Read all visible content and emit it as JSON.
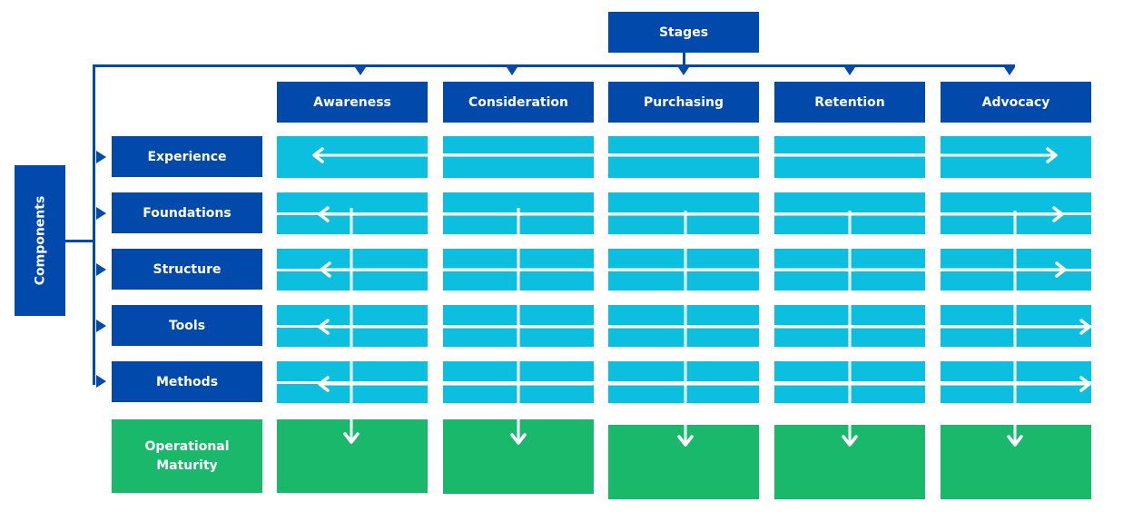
{
  "diagram": {
    "stages_header": "Stages",
    "components_header": "Components",
    "stages": [
      {
        "label": "Awareness"
      },
      {
        "label": "Consideration"
      },
      {
        "label": "Purchasing"
      },
      {
        "label": "Retention"
      },
      {
        "label": "Advocacy"
      }
    ],
    "components": [
      {
        "label": "Experience"
      },
      {
        "label": "Foundations"
      },
      {
        "label": "Structure"
      },
      {
        "label": "Tools"
      },
      {
        "label": "Methods"
      }
    ],
    "outcome": {
      "label_line1": "Operational",
      "label_line2": "Maturity"
    },
    "arrows": {
      "horizontal": "bidirectional arrows spanning all stages for each component",
      "vertical": "down arrows from each stage column into Operational Maturity"
    },
    "colors": {
      "header_navy": "#0249AC",
      "cell_cyan": "#0DBFDF",
      "outcome_green": "#19B86A",
      "connector": "#0249AC",
      "arrow": "#FFFFFF"
    }
  }
}
